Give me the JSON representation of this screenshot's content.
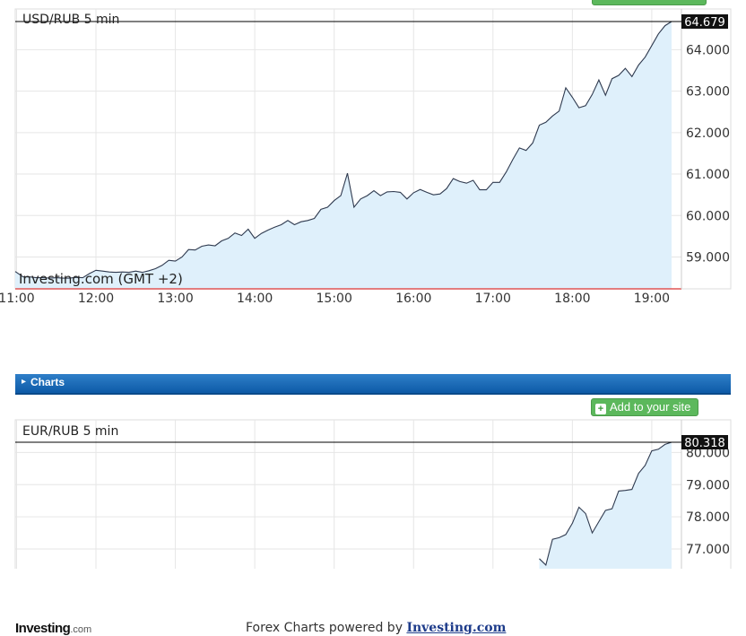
{
  "chart_data": [
    {
      "type": "area",
      "title": "USD/RUB 5 min",
      "x_ticks": [
        "11:00",
        "12:00",
        "13:00",
        "14:00",
        "15:00",
        "16:00",
        "17:00",
        "18:00",
        "19:00"
      ],
      "y_ticks": [
        "59.000",
        "60.000",
        "61.000",
        "62.000",
        "63.000",
        "64.000"
      ],
      "ylim": [
        58.2,
        64.75
      ],
      "xlim": [
        "10:59",
        "19:17"
      ],
      "last_value": "64.679",
      "watermark": "Investing.com (GMT +2)",
      "grid": true,
      "x": [
        "10:59",
        "11:05",
        "11:10",
        "11:15",
        "11:20",
        "11:25",
        "11:30",
        "11:35",
        "11:40",
        "11:45",
        "11:50",
        "11:55",
        "12:00",
        "12:05",
        "12:10",
        "12:15",
        "12:20",
        "12:25",
        "12:30",
        "12:35",
        "12:40",
        "12:45",
        "12:50",
        "12:55",
        "13:00",
        "13:05",
        "13:10",
        "13:15",
        "13:20",
        "13:25",
        "13:30",
        "13:35",
        "13:40",
        "13:45",
        "13:50",
        "13:55",
        "14:00",
        "14:05",
        "14:10",
        "14:15",
        "14:20",
        "14:25",
        "14:30",
        "14:35",
        "14:40",
        "14:45",
        "14:50",
        "14:55",
        "15:00",
        "15:05",
        "15:10",
        "15:15",
        "15:20",
        "15:25",
        "15:30",
        "15:35",
        "15:40",
        "15:45",
        "15:50",
        "15:55",
        "16:00",
        "16:05",
        "16:10",
        "16:15",
        "16:20",
        "16:25",
        "16:30",
        "16:35",
        "16:40",
        "16:45",
        "16:50",
        "16:55",
        "17:00",
        "17:05",
        "17:10",
        "17:15",
        "17:20",
        "17:25",
        "17:30",
        "17:35",
        "17:40",
        "17:45",
        "17:50",
        "17:55",
        "18:00",
        "18:05",
        "18:10",
        "18:15",
        "18:20",
        "18:25",
        "18:30",
        "18:35",
        "18:40",
        "18:45",
        "18:50",
        "18:55",
        "19:00",
        "19:05",
        "19:10",
        "19:15"
      ],
      "values": [
        58.65,
        58.52,
        58.52,
        58.5,
        58.5,
        58.49,
        58.5,
        58.49,
        58.49,
        58.51,
        58.5,
        58.6,
        58.68,
        58.66,
        58.64,
        58.63,
        58.64,
        58.63,
        58.66,
        58.63,
        58.67,
        58.72,
        58.8,
        58.92,
        58.9,
        59.0,
        59.18,
        59.17,
        59.26,
        59.29,
        59.27,
        59.39,
        59.45,
        59.58,
        59.52,
        59.67,
        59.45,
        59.57,
        59.65,
        59.72,
        59.78,
        59.88,
        59.78,
        59.85,
        59.88,
        59.93,
        60.15,
        60.2,
        60.36,
        60.48,
        61.02,
        60.2,
        60.4,
        60.48,
        60.6,
        60.48,
        60.57,
        60.58,
        60.56,
        60.4,
        60.55,
        60.63,
        60.56,
        60.5,
        60.52,
        60.65,
        60.89,
        60.82,
        60.78,
        60.85,
        60.62,
        60.62,
        60.8,
        60.8,
        61.05,
        61.35,
        61.63,
        61.57,
        61.75,
        62.18,
        62.25,
        62.4,
        62.52,
        63.08,
        62.85,
        62.6,
        62.65,
        62.92,
        63.27,
        62.9,
        63.3,
        63.38,
        63.55,
        63.35,
        63.63,
        63.82,
        64.1,
        64.38,
        64.58,
        64.679
      ]
    },
    {
      "type": "area",
      "title": "EUR/RUB 5 min",
      "y_ticks": [
        "77.000",
        "78.000",
        "79.000",
        "80.000"
      ],
      "ylim": [
        76.45,
        80.85
      ],
      "xlim": [
        "10:59",
        "19:17"
      ],
      "last_value": "80.318",
      "grid": true,
      "x": [
        "17:35",
        "17:40",
        "17:45",
        "17:50",
        "17:55",
        "18:00",
        "18:05",
        "18:10",
        "18:15",
        "18:20",
        "18:25",
        "18:30",
        "18:35",
        "18:40",
        "18:45",
        "18:50",
        "18:55",
        "19:00",
        "19:05",
        "19:10",
        "19:15"
      ],
      "values": [
        76.7,
        76.5,
        77.3,
        77.35,
        77.45,
        77.8,
        78.3,
        78.1,
        77.5,
        77.85,
        78.2,
        78.25,
        78.8,
        78.82,
        78.85,
        79.35,
        79.6,
        80.05,
        80.1,
        80.25,
        80.318
      ]
    }
  ],
  "footer": {
    "logo_main": "Investing",
    "logo_suffix": ".com",
    "powered_prefix": "Forex Charts powered by",
    "powered_link": "Investing.com"
  },
  "section": {
    "title": "Charts"
  },
  "add_button": {
    "label": "Add to your site"
  },
  "colors": {
    "line": "#2f3a4f",
    "area_fill": "#dff0fb",
    "grid": "#e6e6e6",
    "last_price_line": "#000000",
    "bottom_axis_line": "#e05555",
    "section_bar": "#1565b5",
    "button_green": "#5cb85c"
  }
}
